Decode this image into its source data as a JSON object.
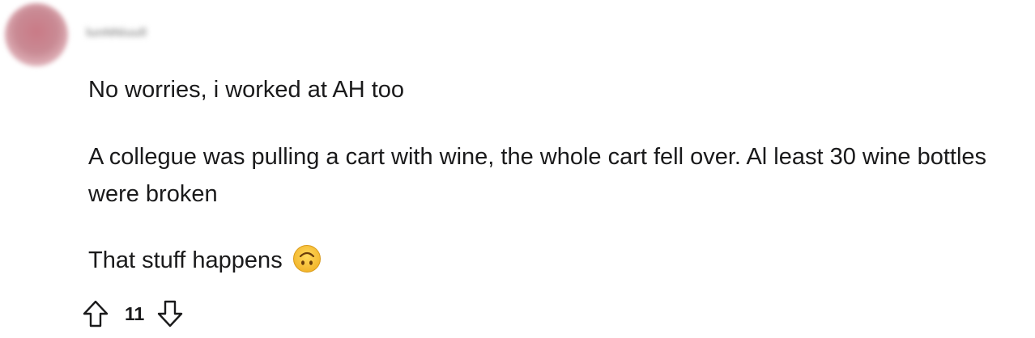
{
  "comment": {
    "username": "lunNNiuull",
    "paragraphs": [
      "No worries, i worked at AH too",
      "A collegue was pulling a cart with wine, the whole cart fell over. Al least 30 wine bottles were broken",
      "That stuff happens"
    ],
    "emoji": "upside-down-face",
    "score": "11",
    "upvote_icon": "arrow-up-outline-icon",
    "downvote_icon": "arrow-down-outline-icon",
    "colors": {
      "text": "#1a1a1b",
      "emoji_fill": "#f7c43a",
      "emoji_stroke": "#c88a12"
    }
  }
}
